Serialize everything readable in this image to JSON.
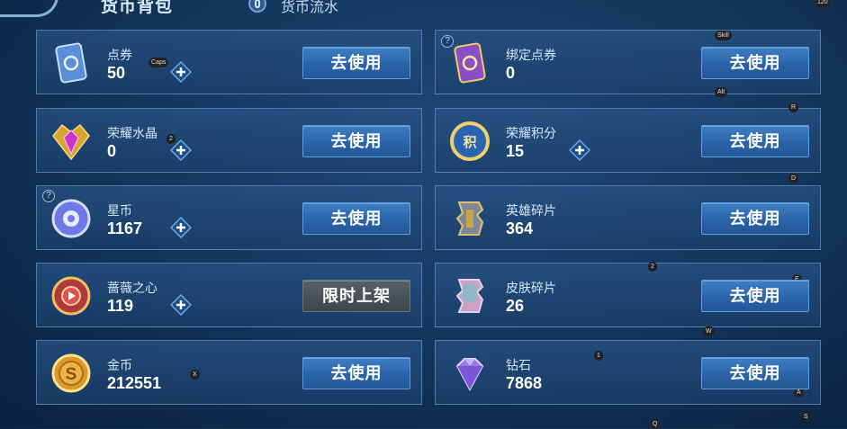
{
  "header": {
    "tab_active": "货币背包",
    "tab_flow": "货币流水"
  },
  "currencies": [
    {
      "name": "点券",
      "value": "50",
      "action": "去使用"
    },
    {
      "name": "绑定点券",
      "value": "0",
      "action": "去使用"
    },
    {
      "name": "荣耀水晶",
      "value": "0",
      "action": "去使用"
    },
    {
      "name": "荣耀积分",
      "value": "15",
      "action": "去使用"
    },
    {
      "name": "星币",
      "value": "1167",
      "action": "去使用"
    },
    {
      "name": "英雄碎片",
      "value": "364",
      "action": "去使用"
    },
    {
      "name": "蔷薇之心",
      "value": "119",
      "action": "限时上架"
    },
    {
      "name": "皮肤碎片",
      "value": "26",
      "action": "去使用"
    },
    {
      "name": "金币",
      "value": "212551",
      "action": "去使用"
    },
    {
      "name": "钻石",
      "value": "7868",
      "action": "去使用"
    }
  ],
  "overlay_labels": {
    "caps": "Caps",
    "skill": "Skill",
    "alt": "Alt",
    "r": "R",
    "d": "D",
    "two_a": "2",
    "two_b": "2",
    "e": "E",
    "w": "W",
    "one": "1",
    "a": "A",
    "s": "S",
    "q": "Q",
    "x": "X",
    "top_right": "120"
  },
  "colors": {
    "button_blue": "#2b64a8",
    "button_gray": "#4a5058",
    "card_bg": "#1f4a7c"
  }
}
